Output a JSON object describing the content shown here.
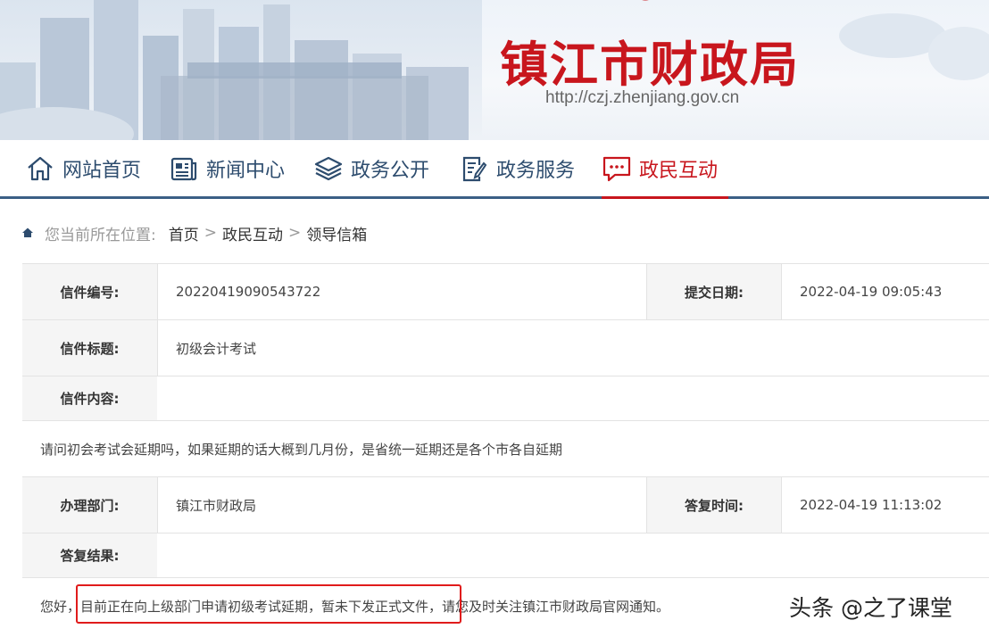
{
  "banner": {
    "title": "镇江市财政局",
    "url": "http://czj.zhenjiang.gov.cn"
  },
  "nav": {
    "items": [
      {
        "label": "网站首页",
        "icon": "home-icon"
      },
      {
        "label": "新闻中心",
        "icon": "newspaper-icon"
      },
      {
        "label": "政务公开",
        "icon": "layers-icon"
      },
      {
        "label": "政务服务",
        "icon": "document-edit-icon"
      },
      {
        "label": "政民互动",
        "icon": "chat-bubble-icon",
        "active": true
      }
    ]
  },
  "breadcrumb": {
    "prefix": "您当前所在位置:",
    "items": [
      "首页",
      "政民互动",
      "领导信箱"
    ],
    "separator": ">"
  },
  "letter": {
    "number_label": "信件编号:",
    "number": "20220419090543722",
    "submit_date_label": "提交日期:",
    "submit_date": "2022-04-19 09:05:43",
    "title_label": "信件标题:",
    "title": "初级会计考试",
    "content_label": "信件内容:",
    "content": "请问初会考试会延期吗，如果延期的话大概到几月份，是省统一延期还是各个市各自延期",
    "dept_label": "办理部门:",
    "dept": "镇江市财政局",
    "reply_time_label": "答复时间:",
    "reply_time": "2022-04-19 11:13:02",
    "result_label": "答复结果:",
    "result_part1": "您好，",
    "result_part2": "目前正在向上级部门申请初级考试延期，暂未下发正式文件，",
    "result_part3": "请您及时关注镇江市财政局官网通知。"
  },
  "watermark": "头条 @之了课堂",
  "colors": {
    "brand_red": "#c8161d",
    "nav_blue": "#2d4c6e",
    "highlight_red": "#e01b1b"
  }
}
